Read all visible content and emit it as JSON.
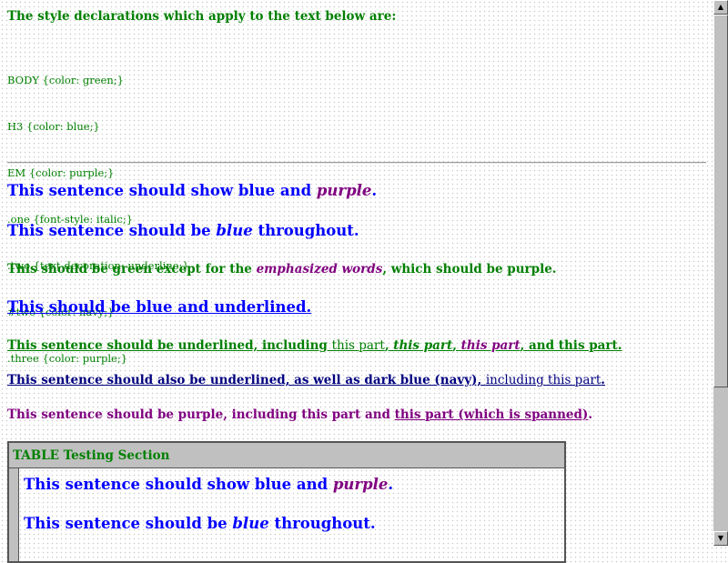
{
  "declarations": {
    "title": "The style declarations which apply to the text below are:",
    "rules": [
      "BODY {color: green;}",
      "H3 {color: blue;}",
      "EM {color: purple;}",
      ".one {font-style: italic;}",
      ".two {text-decoration: underline;}",
      "#two {color: navy;}",
      ".three {color: purple;}"
    ]
  },
  "lines": {
    "l1_pre": "This sentence should show blue and ",
    "l1_em": "purple",
    "l1_post": ".",
    "l2_pre": "This sentence should be ",
    "l2_em": "blue",
    "l2_post": " throughout.",
    "l3_pre": "This should be green except for the ",
    "l3_em": "emphasized words",
    "l3_post": ", which should be purple.",
    "l4": "This should be blue and underlined.",
    "l5_pre": "This sentence should be underlined, including ",
    "l5_tt": "this part",
    "l5_sep1": ", ",
    "l5_i": "this part",
    "l5_sep2": ", ",
    "l5_em": "this part",
    "l5_post": ", and this part.",
    "l6_pre": "This sentence should also be underlined, as well as dark blue (navy), ",
    "l6_tt": "including this part",
    "l6_post": ".",
    "l7_pre": "This sentence should be purple, including this part and ",
    "l7_span": "this part (which is spanned)",
    "l7_post": "."
  },
  "table": {
    "header": "TABLE Testing Section",
    "t1_pre": "This sentence should show blue and ",
    "t1_em": "purple",
    "t1_post": ".",
    "t2_pre": "This sentence should be ",
    "t2_em": "blue",
    "t2_post": " throughout."
  },
  "colors": {
    "body": "#008000",
    "h3": "#0000ff",
    "em": "#800080",
    "navy": "#000080"
  }
}
